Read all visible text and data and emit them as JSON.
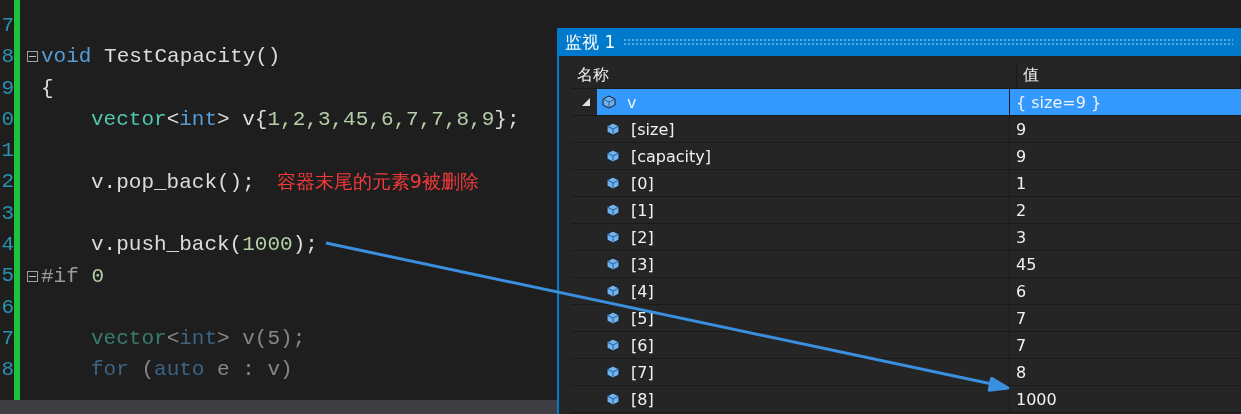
{
  "editor": {
    "lines": [
      {
        "number": "7",
        "fold": false
      },
      {
        "number": "8",
        "fold": true,
        "indented": false,
        "dimmed": false,
        "tokens": [
          {
            "kind": "keyword",
            "text": "void"
          },
          {
            "kind": "plain",
            "text": " TestCapacity()"
          }
        ]
      },
      {
        "number": "9",
        "fold": false,
        "indented": false,
        "dimmed": false,
        "tokens": [
          {
            "kind": "plain",
            "text": "{"
          }
        ]
      },
      {
        "number": "0",
        "fold": false,
        "indented": true,
        "dimmed": false,
        "tokens": [
          {
            "kind": "type",
            "text": "vector"
          },
          {
            "kind": "plain",
            "text": "<"
          },
          {
            "kind": "keyword",
            "text": "int"
          },
          {
            "kind": "plain",
            "text": "> v{"
          },
          {
            "kind": "number",
            "text": "1,2,3,45,6,7,7,8,9"
          },
          {
            "kind": "plain",
            "text": "};"
          }
        ]
      },
      {
        "number": "1",
        "fold": false
      },
      {
        "number": "2",
        "fold": false,
        "indented": true,
        "dimmed": false,
        "tokens": [
          {
            "kind": "plain",
            "text": "v.pop_back();"
          }
        ],
        "note": "容器末尾的元素9被删除"
      },
      {
        "number": "3",
        "fold": false
      },
      {
        "number": "4",
        "fold": false,
        "indented": true,
        "dimmed": false,
        "tokens": [
          {
            "kind": "plain",
            "text": "v.push_back("
          },
          {
            "kind": "number",
            "text": "1000"
          },
          {
            "kind": "plain",
            "text": ");"
          }
        ]
      },
      {
        "number": "5",
        "fold": true,
        "indented": false,
        "dimmed": false,
        "tokens": [
          {
            "kind": "preprocessor",
            "text": "#if"
          },
          {
            "kind": "number",
            "text": " 0"
          }
        ]
      },
      {
        "number": "6",
        "fold": false
      },
      {
        "number": "7",
        "fold": false,
        "indented": true,
        "dimmed": true,
        "tokens": [
          {
            "kind": "type",
            "text": "vector"
          },
          {
            "kind": "plain",
            "text": "<"
          },
          {
            "kind": "keyword",
            "text": "int"
          },
          {
            "kind": "plain",
            "text": "> v(5);"
          }
        ]
      },
      {
        "number": "8",
        "fold": false,
        "indented": true,
        "dimmed": true,
        "tokens": [
          {
            "kind": "keyword",
            "text": "for"
          },
          {
            "kind": "plain",
            "text": " ("
          },
          {
            "kind": "keyword",
            "text": "auto"
          },
          {
            "kind": "plain",
            "text": " e : v)"
          }
        ]
      }
    ]
  },
  "watch": {
    "title": "监视 1",
    "columns": [
      "名称",
      "值"
    ],
    "rows": [
      {
        "name": "v",
        "value": "{ size=9 }",
        "expanded": true,
        "selected": true,
        "children": [
          {
            "name": "[size]",
            "value": "9",
            "selected": false
          },
          {
            "name": "[capacity]",
            "value": "9",
            "selected": false
          },
          {
            "name": "[0]",
            "value": "1",
            "selected": false
          },
          {
            "name": "[1]",
            "value": "2",
            "selected": false
          },
          {
            "name": "[2]",
            "value": "3",
            "selected": false
          },
          {
            "name": "[3]",
            "value": "45",
            "selected": false
          },
          {
            "name": "[4]",
            "value": "6",
            "selected": false
          },
          {
            "name": "[5]",
            "value": "7",
            "selected": false
          },
          {
            "name": "[6]",
            "value": "7",
            "selected": false
          },
          {
            "name": "[7]",
            "value": "8",
            "selected": false
          },
          {
            "name": "[8]",
            "value": "1000",
            "selected": false
          }
        ]
      }
    ]
  }
}
